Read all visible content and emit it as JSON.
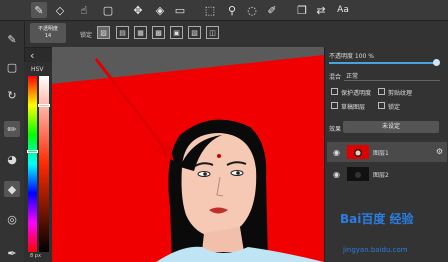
{
  "toolbar": {
    "tools": [
      "brush-icon",
      "eraser-icon",
      "smudge-icon",
      "transform-icon",
      "move-icon",
      "fill-icon",
      "gradient-icon",
      "select-icon",
      "magic-wand-icon",
      "lasso-icon",
      "edit-icon",
      "copy-icon",
      "text-icon"
    ],
    "text_tool_label": "Aa"
  },
  "subbar": {
    "opacity_label": "不透明度",
    "opacity_value": "14",
    "lock_label": "锁定"
  },
  "color_panel": {
    "mode_label": "HSV",
    "size_label": "8 px"
  },
  "right_panel": {
    "opacity_text": "不透明度 100 %",
    "blend_label": "混合",
    "blend_value": "正常",
    "protect_alpha": "保护透明度",
    "clipping": "剪贴纹理",
    "draft_layer": "草稿图层",
    "lock": "锁定",
    "effect_label": "效果",
    "effect_button": "未设定",
    "layers": [
      {
        "name": "图层1"
      },
      {
        "name": "图层2"
      }
    ]
  },
  "watermark": {
    "brand": "Bai百度 经验",
    "url": "jingyan.baidu.com"
  },
  "colors": {
    "canvas_red": "#f00000",
    "accent_blue": "#4aa3df",
    "arrow_red": "#e00000"
  }
}
